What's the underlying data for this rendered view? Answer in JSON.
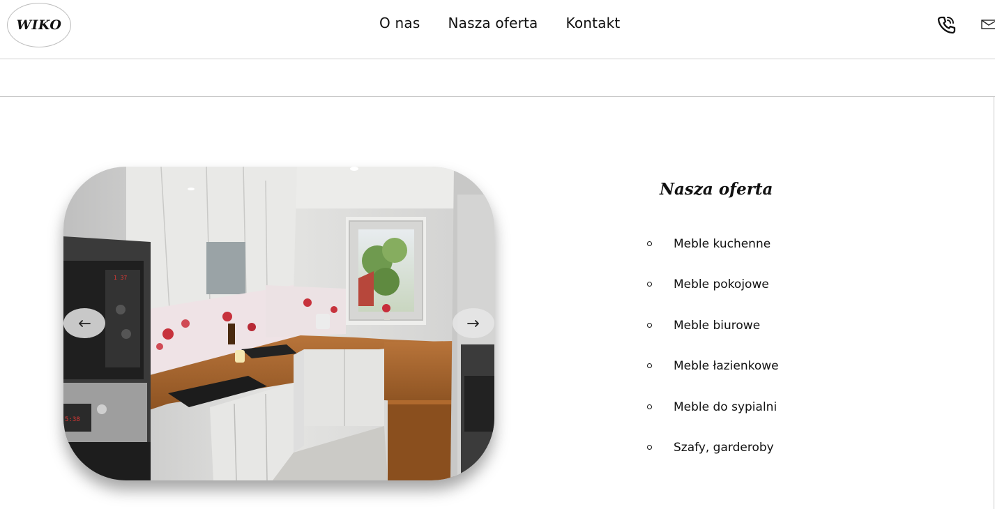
{
  "header": {
    "logo_text": "WIKO",
    "nav": [
      "O nas",
      "Nasza oferta",
      "Kontakt"
    ]
  },
  "icons": {
    "phone": "phone-icon",
    "mail": "mail-icon",
    "arrow_prev": "arrow-left-icon",
    "arrow_next": "arrow-right-icon"
  },
  "slider": {
    "current_image": "kitchen-photo"
  },
  "offer": {
    "title": "Nasza oferta",
    "items": [
      "Meble kuchenne",
      "Meble pokojowe",
      "Meble biurowe",
      "Meble łazienkowe",
      "Meble do sypialni",
      "Szafy, garderoby"
    ]
  }
}
